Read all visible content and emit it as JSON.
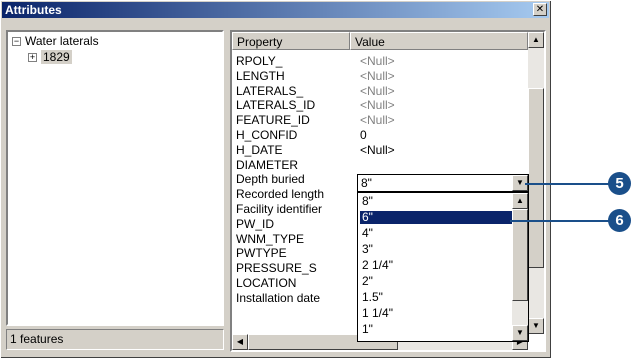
{
  "window": {
    "title": "Attributes",
    "close_glyph": "✕"
  },
  "tree": {
    "root_label": "Water laterals",
    "root_expander": "−",
    "child_label": "1829",
    "child_expander": "+"
  },
  "status": {
    "text": "1 features"
  },
  "table": {
    "headers": {
      "property": "Property",
      "value": "Value"
    },
    "rows": [
      {
        "property": "RPOLY_",
        "value": "<Null>",
        "is_null": true
      },
      {
        "property": "LENGTH",
        "value": "<Null>",
        "is_null": true
      },
      {
        "property": "LATERALS_",
        "value": "<Null>",
        "is_null": true
      },
      {
        "property": "LATERALS_ID",
        "value": "<Null>",
        "is_null": true
      },
      {
        "property": "FEATURE_ID",
        "value": "<Null>",
        "is_null": true
      },
      {
        "property": "H_CONFID",
        "value": "0",
        "is_null": false
      },
      {
        "property": "H_DATE",
        "value": "<Null>",
        "is_null": false
      },
      {
        "property": "DIAMETER",
        "value": "",
        "is_null": false
      },
      {
        "property": "Depth buried",
        "value": "",
        "is_null": false
      },
      {
        "property": "Recorded length",
        "value": "",
        "is_null": false
      },
      {
        "property": "Facility identifier",
        "value": "",
        "is_null": false
      },
      {
        "property": "PW_ID",
        "value": "",
        "is_null": false
      },
      {
        "property": "WNM_TYPE",
        "value": "",
        "is_null": false
      },
      {
        "property": "PWTYPE",
        "value": "",
        "is_null": false
      },
      {
        "property": "PRESSURE_S",
        "value": "",
        "is_null": false
      },
      {
        "property": "LOCATION",
        "value": "",
        "is_null": false
      },
      {
        "property": "Installation date",
        "value": "",
        "is_null": false
      }
    ]
  },
  "diameter_combo": {
    "value": "8\"",
    "options": [
      "8\"",
      "6\"",
      "4\"",
      "3\"",
      "2 1/4\"",
      "2\"",
      "1.5\"",
      "1 1/4\"",
      "1\""
    ],
    "highlighted_index": 1
  },
  "callouts": {
    "step5": "5",
    "step6": "6"
  },
  "colors": {
    "callout": "#1a4f8a",
    "selection": "#0a246a",
    "titlebar": "#0a246a"
  }
}
